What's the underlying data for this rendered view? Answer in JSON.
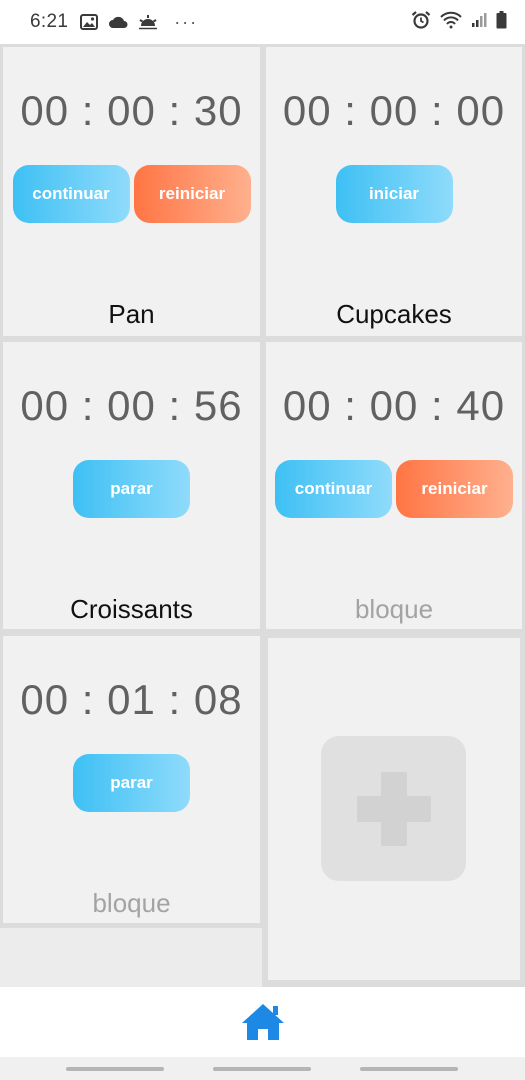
{
  "status_bar": {
    "time": "6:21",
    "icons_left": [
      "image-icon",
      "cloud-icon",
      "weather-icon"
    ],
    "overflow": "···",
    "icons_right": [
      "alarm-icon",
      "wifi-icon",
      "signal-icon",
      "battery-icon"
    ]
  },
  "timers": [
    {
      "time": "00 : 00 : 30",
      "buttons": [
        {
          "label": "continuar",
          "style": "blue"
        },
        {
          "label": "reiniciar",
          "style": "orange"
        }
      ],
      "name": "Pan",
      "name_muted": false
    },
    {
      "time": "00 : 00 : 00",
      "buttons": [
        {
          "label": "iniciar",
          "style": "blue"
        }
      ],
      "name": "Cupcakes",
      "name_muted": false
    },
    {
      "time": "00 : 00 : 56",
      "buttons": [
        {
          "label": "parar",
          "style": "blue"
        }
      ],
      "name": "Croissants",
      "name_muted": false
    },
    {
      "time": "00 : 00 : 40",
      "buttons": [
        {
          "label": "continuar",
          "style": "blue"
        },
        {
          "label": "reiniciar",
          "style": "orange"
        }
      ],
      "name": "bloque",
      "name_muted": true
    },
    {
      "time": "00 : 01 : 08",
      "buttons": [
        {
          "label": "parar",
          "style": "blue"
        }
      ],
      "name": "bloque",
      "name_muted": true
    }
  ],
  "add_tile": {
    "icon": "plus-icon"
  },
  "bottom_nav": {
    "icon": "home-icon",
    "color": "#1e88e5"
  },
  "colors": {
    "button_blue": "#3ec0f4",
    "button_orange": "#ff7544",
    "card_bg": "#f1f1f1",
    "timer_text": "#616161"
  }
}
